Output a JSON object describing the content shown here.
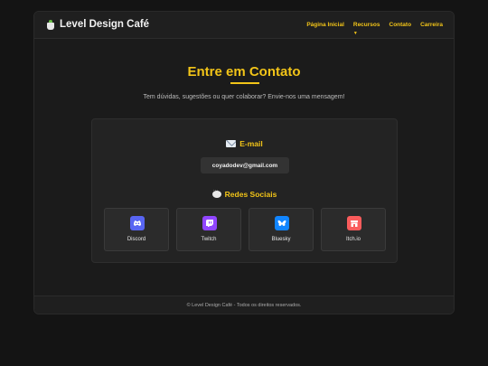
{
  "brand": {
    "title": "Level Design Café",
    "icon": "coffee-cup-icon"
  },
  "nav": {
    "items": [
      {
        "label": "Página Inicial"
      },
      {
        "label": "Recursos",
        "arrow": "▼"
      },
      {
        "label": "Contato"
      },
      {
        "label": "Carreira"
      }
    ]
  },
  "hero": {
    "title": "Entre em Contato",
    "subtitle": "Tem dúvidas, sugestões ou quer colaborar? Envie-nos uma mensagem!"
  },
  "email": {
    "heading": "E-mail",
    "icon": "envelope-icon",
    "address": "coyadodev@gmail.com"
  },
  "social": {
    "heading": "Redes Sociais",
    "icon": "speech-bubble-icon",
    "items": [
      {
        "label": "Discord",
        "icon": "discord-icon",
        "color": "#5865f2"
      },
      {
        "label": "Twitch",
        "icon": "twitch-icon",
        "color": "#9146ff"
      },
      {
        "label": "Bluesky",
        "icon": "bluesky-icon",
        "color": "#1185fe"
      },
      {
        "label": "Itch.io",
        "icon": "itchio-icon",
        "color": "#fa5c5c"
      }
    ]
  },
  "footer": {
    "text": "© Level Design Café - Todos os direitos reservados."
  },
  "colors": {
    "accent": "#f2c418",
    "background": "#141414",
    "card": "#232323"
  }
}
